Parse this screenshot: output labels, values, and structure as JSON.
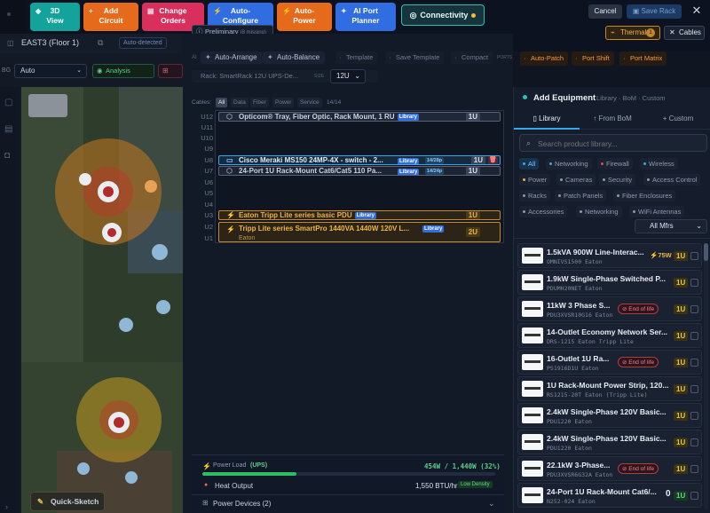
{
  "toolbar": {
    "buttons": [
      {
        "label": "3D View",
        "line1": "3D",
        "line2": "View"
      },
      {
        "line1": "Add",
        "line2": "Circuit"
      },
      {
        "line1": "Change",
        "line2": "Orders"
      },
      {
        "line1": "Auto-",
        "line2": "Configure"
      },
      {
        "line1": "Auto-",
        "line2": "Power"
      },
      {
        "line1": "AI Port",
        "line2": "Planner"
      }
    ],
    "connectivity": "Connectivity",
    "cancel": "Cancel",
    "save": "Save Rack",
    "thermal": "Thermal",
    "thermal_count": "1",
    "cables": "Cables",
    "preliminary": "Preliminary",
    "preliminary_note": "(8 missing)"
  },
  "map": {
    "floor": "EAST3 (Floor 1)",
    "auto_detected": "Auto-detected",
    "bg_label": "BG",
    "bg_value": "Auto",
    "analysis": "Analysis",
    "quick_sketch": "Quick-Sketch"
  },
  "rack_toolbar": {
    "ai_label": "AI",
    "auto_arrange": "Auto-Arrange",
    "auto_balance": "Auto-Balance",
    "template": "Template",
    "save_template": "Save Template",
    "compact": "Compact",
    "ports_label": "PORTS",
    "auto_patch": "Auto-Patch",
    "port_shift": "Port Shift",
    "port_matrix": "Port Matrix",
    "rack_name": "Rack: SmartRack 12U UPS-De...",
    "size_label": "SIZE",
    "size_value": "12U"
  },
  "cables_filter": {
    "label": "Cables:",
    "options": [
      "All",
      "Data",
      "Fiber",
      "Power",
      "Service"
    ],
    "count": "14/14"
  },
  "rack": {
    "slots": [
      "U12",
      "U11",
      "U10",
      "U9",
      "U8",
      "U7",
      "U6",
      "U5",
      "U4",
      "U3",
      "U2",
      "U1"
    ],
    "devices": [
      {
        "name": "Opticom® Tray, Fiber Optic, Rack Mount, 1 RU",
        "tag": "Library",
        "u": "1U"
      },
      {
        "name": "Cisco Meraki MS150 24MP-4X - switch - 2...",
        "tag": "Library",
        "ports": "14/28p",
        "u": "1U"
      },
      {
        "name": "24-Port 1U Rack-Mount Cat6/Cat5 110 Pa...",
        "tag": "Library",
        "ports": "14/24p",
        "u": "1U"
      },
      {
        "name": "Eaton Tripp Lite series basic PDU",
        "tag": "Library",
        "u": "1U"
      },
      {
        "name": "Tripp Lite series SmartPro 1440VA 1440W 120V L...",
        "tag": "Library",
        "sub": "Eaton",
        "u": "2U"
      }
    ]
  },
  "footer": {
    "power_load_label": "Power Load",
    "power_load_tag": "(UPS)",
    "power_load_value": "454W / 1,440W (32%)",
    "power_fraction": 0.32,
    "heat_label": "Heat Output",
    "heat_value": "1,550 BTU/hr",
    "heat_badge": "Low Density",
    "power_devices": "Power Devices (2)"
  },
  "equipment": {
    "title": "Add Equipment",
    "crumbs": "Library · BoM · Custom",
    "tabs": [
      "Library",
      "From BoM",
      "Custom"
    ],
    "search_placeholder": "Search product library...",
    "categories": [
      "All",
      "Networking",
      "Firewall",
      "Wireless",
      "Power",
      "Cameras",
      "Security",
      "Access Control",
      "Racks",
      "Patch Panels",
      "Fiber Enclosures",
      "Accessories",
      "Networking",
      "WiFi Antennas"
    ],
    "mfr_select": "All Mfrs",
    "products": [
      {
        "name": "1.5kVA 900W Line-Interac...",
        "sku": "OMNIVS1500",
        "mfr": "Eaton",
        "watts": "75W",
        "u": "1U"
      },
      {
        "name": "1.9kW Single-Phase Switched P...",
        "sku": "PDUMH20NET",
        "mfr": "Eaton",
        "u": "1U"
      },
      {
        "name": "11kW 3 Phase S...",
        "sku": "PDU3XVSR10G16",
        "mfr": "Eaton",
        "eol": "End of life",
        "u": "1U"
      },
      {
        "name": "14-Outlet Economy Network Ser...",
        "sku": "DRS-1215",
        "mfr": "Eaton Tripp Lite",
        "u": "1U"
      },
      {
        "name": "16-Outlet 1U Ra...",
        "sku": "PS1916D1U",
        "mfr": "Eaton",
        "eol": "End of life",
        "u": "1U"
      },
      {
        "name": "1U Rack-Mount Power Strip, 120...",
        "sku": "RS1215-20T",
        "mfr": "Eaton (Tripp Lite)",
        "u": "1U"
      },
      {
        "name": "2.4kW Single-Phase 120V Basic...",
        "sku": "PDU1220",
        "mfr": "Eaton",
        "u": "1U"
      },
      {
        "name": "2.4kW Single-Phase 120V Basic...",
        "sku": "PDU1220",
        "mfr": "Eaton",
        "u": "1U"
      },
      {
        "name": "22.1kW 3-Phase...",
        "sku": "PDU3XVSR6G32A",
        "mfr": "Eaton",
        "eol": "End of life",
        "u": "1U"
      },
      {
        "name": "24-Port 1U Rack-Mount Cat6/...",
        "sku": "N252-024",
        "mfr": "Eaton",
        "count": "0",
        "u": "1U",
        "green": true
      }
    ]
  }
}
